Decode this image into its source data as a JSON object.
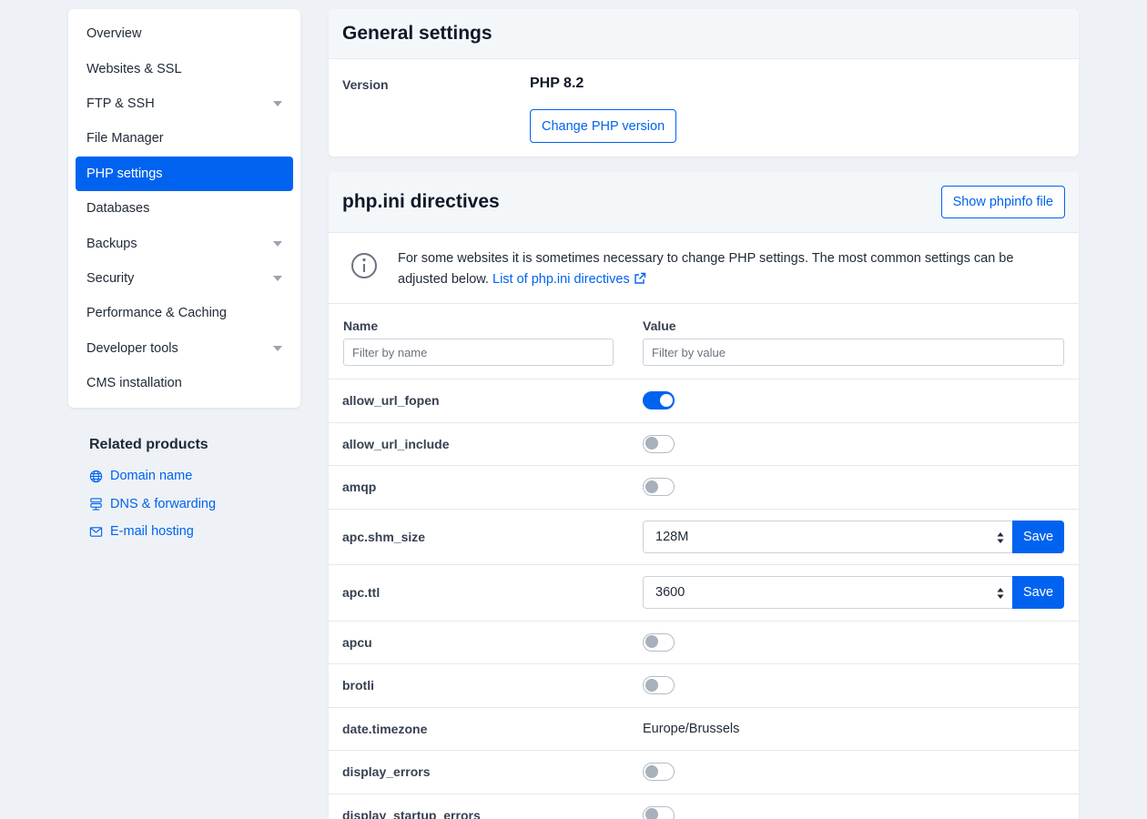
{
  "sidebar": {
    "items": [
      {
        "label": "Overview",
        "active": false,
        "expandable": false
      },
      {
        "label": "Websites & SSL",
        "active": false,
        "expandable": false
      },
      {
        "label": "FTP & SSH",
        "active": false,
        "expandable": true
      },
      {
        "label": "File Manager",
        "active": false,
        "expandable": false
      },
      {
        "label": "PHP settings",
        "active": true,
        "expandable": false
      },
      {
        "label": "Databases",
        "active": false,
        "expandable": false
      },
      {
        "label": "Backups",
        "active": false,
        "expandable": true
      },
      {
        "label": "Security",
        "active": false,
        "expandable": true
      },
      {
        "label": "Performance & Caching",
        "active": false,
        "expandable": false
      },
      {
        "label": "Developer tools",
        "active": false,
        "expandable": true
      },
      {
        "label": "CMS installation",
        "active": false,
        "expandable": false
      }
    ]
  },
  "related": {
    "title": "Related products",
    "links": [
      {
        "label": "Domain name",
        "icon": "globe-icon"
      },
      {
        "label": "DNS & forwarding",
        "icon": "dns-server-icon"
      },
      {
        "label": "E-mail hosting",
        "icon": "envelope-icon"
      }
    ]
  },
  "general": {
    "title": "General settings",
    "version_label": "Version",
    "version_value": "PHP 8.2",
    "change_button": "Change PHP version"
  },
  "directives": {
    "title": "php.ini directives",
    "phpinfo_button": "Show phpinfo file",
    "info_text": "For some websites it is sometimes necessary to change PHP settings. The most common settings can be adjusted below.",
    "info_link": "List of php.ini directives",
    "columns": {
      "name": "Name",
      "value": "Value"
    },
    "filter_name_placeholder": "Filter by name",
    "filter_value_placeholder": "Filter by value",
    "rows": [
      {
        "name": "allow_url_fopen",
        "type": "toggle",
        "on": true
      },
      {
        "name": "allow_url_include",
        "type": "toggle",
        "on": false
      },
      {
        "name": "amqp",
        "type": "toggle",
        "on": false
      },
      {
        "name": "apc.shm_size",
        "type": "select",
        "value": "128M",
        "save": "Save"
      },
      {
        "name": "apc.ttl",
        "type": "select",
        "value": "3600",
        "save": "Save"
      },
      {
        "name": "apcu",
        "type": "toggle",
        "on": false
      },
      {
        "name": "brotli",
        "type": "toggle",
        "on": false
      },
      {
        "name": "date.timezone",
        "type": "text",
        "value": "Europe/Brussels"
      },
      {
        "name": "display_errors",
        "type": "toggle",
        "on": false
      },
      {
        "name": "display_startup_errors",
        "type": "toggle",
        "on": false
      }
    ]
  },
  "colors": {
    "accent": "#0063f0",
    "background": "#eef2f6"
  }
}
